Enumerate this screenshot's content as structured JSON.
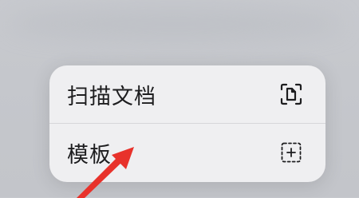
{
  "context_menu": {
    "items": [
      {
        "label": "扫描文档",
        "icon": "document-scan-icon"
      },
      {
        "label": "模板",
        "icon": "add-template-icon"
      }
    ]
  },
  "colors": {
    "menu_background": "#efeff1",
    "text": "#1d1d1f",
    "arrow": "#e8322b"
  }
}
